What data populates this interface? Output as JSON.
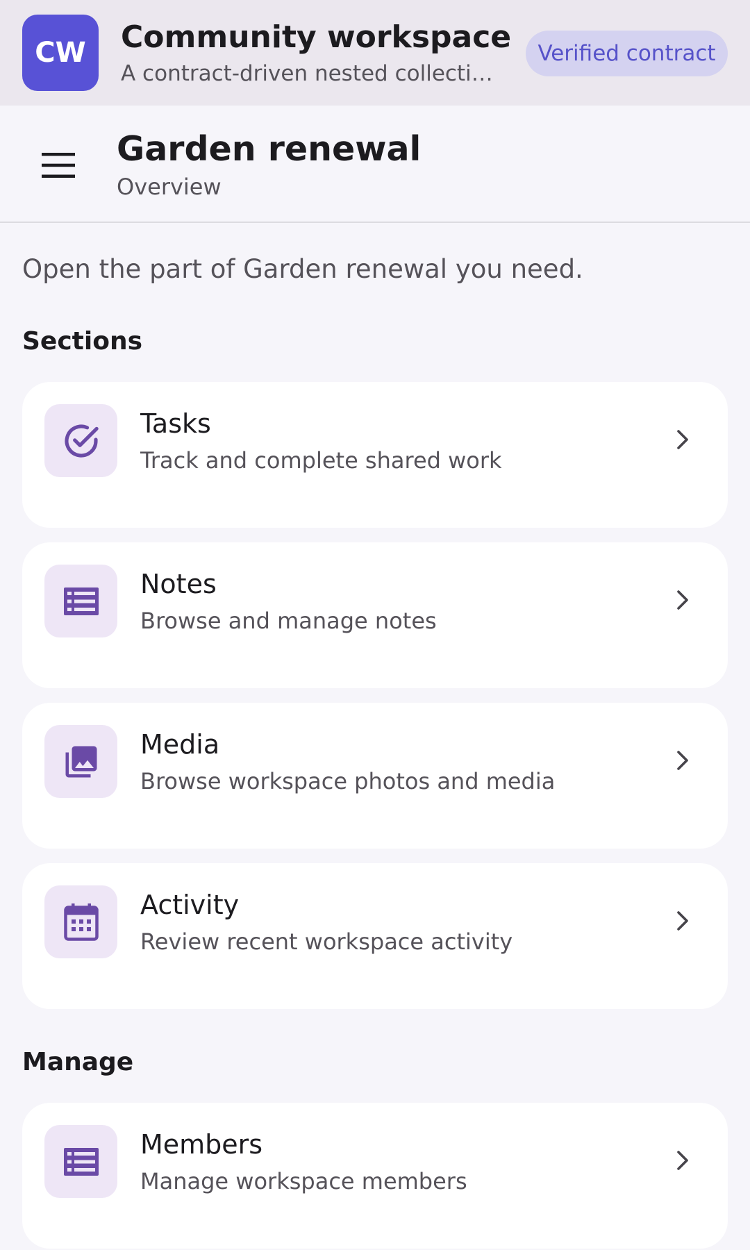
{
  "workspace": {
    "initials": "CW",
    "title": "Community workspace",
    "subtitle": "A contract-driven nested collection ...",
    "badge": "Verified contract"
  },
  "appbar": {
    "title": "Garden renewal",
    "subtitle": "Overview"
  },
  "intro": "Open the part of Garden renewal you need.",
  "sections": {
    "heading": "Sections",
    "items": [
      {
        "icon": "check-circle-icon",
        "title": "Tasks",
        "description": "Track and complete shared work"
      },
      {
        "icon": "list-icon",
        "title": "Notes",
        "description": "Browse and manage notes"
      },
      {
        "icon": "photo-library-icon",
        "title": "Media",
        "description": "Browse workspace photos and media"
      },
      {
        "icon": "calendar-icon",
        "title": "Activity",
        "description": "Review recent workspace activity"
      }
    ]
  },
  "manage": {
    "heading": "Manage",
    "items": [
      {
        "icon": "list-icon",
        "title": "Members",
        "description": "Manage workspace members"
      }
    ]
  },
  "colors": {
    "accent": "#5852d6",
    "icon_tint": "#6a4aa6",
    "icon_bg": "#eee6f6",
    "badge_bg": "#d4d2f0",
    "badge_text": "#5652c9"
  }
}
